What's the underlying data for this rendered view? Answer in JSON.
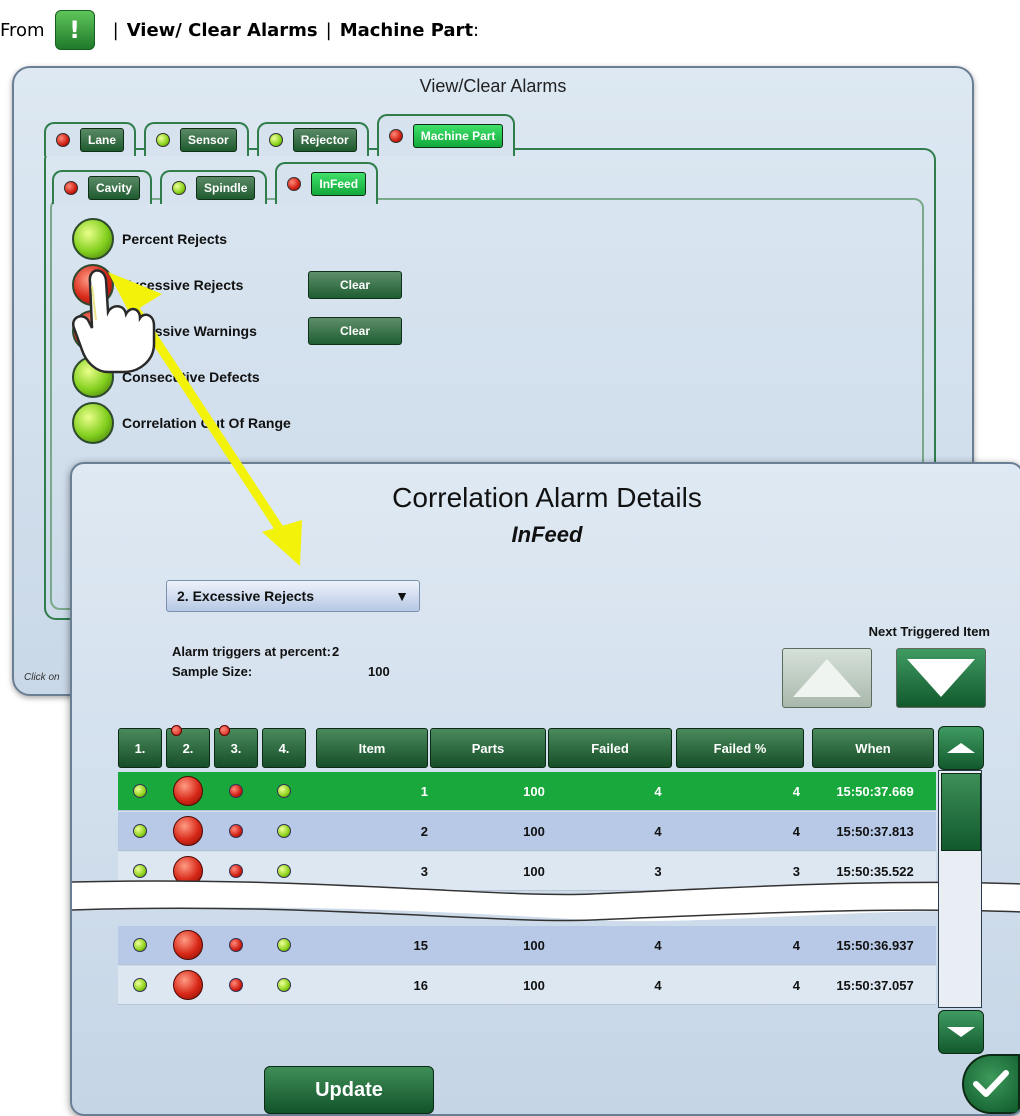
{
  "doc": {
    "prefix": "From",
    "icon_glyph": "!",
    "sep1": "|",
    "item1": "View/ Clear Alarms",
    "sep2": "|",
    "item2": "Machine Part",
    "suffix": ":"
  },
  "back_window": {
    "title": "View/Clear Alarms",
    "tabs": [
      {
        "label": "Lane",
        "led": "red"
      },
      {
        "label": "Sensor",
        "led": "green"
      },
      {
        "label": "Rejector",
        "led": "green"
      },
      {
        "label": "Machine Part",
        "led": "red",
        "active": true
      }
    ],
    "subtabs": [
      {
        "label": "Cavity",
        "led": "red"
      },
      {
        "label": "Spindle",
        "led": "green"
      },
      {
        "label": "InFeed",
        "led": "red",
        "active": true
      }
    ],
    "alarms": [
      {
        "label": "Percent Rejects",
        "led": "green"
      },
      {
        "label": "Excessive Rejects",
        "led": "red",
        "clear": "Clear"
      },
      {
        "label": "Excessive Warnings",
        "led": "red",
        "clear": "Clear"
      },
      {
        "label": "Consecutive Defects",
        "led": "green"
      },
      {
        "label": "Correlation Out Of Range",
        "led": "green"
      }
    ],
    "hint": "Click on"
  },
  "front_window": {
    "title": "Correlation Alarm Details",
    "subtitle": "InFeed",
    "dropdown_value": "2. Excessive Rejects",
    "dropdown_arrow": "▼",
    "next_triggered_label": "Next Triggered Item",
    "alarm_triggers_label": "Alarm triggers at percent:",
    "alarm_triggers_value": "2",
    "sample_size_label": "Sample Size:",
    "sample_size_value": "100",
    "columns": [
      "1.",
      "2.",
      "3.",
      "4.",
      "Item",
      "Parts",
      "Failed",
      "Failed %",
      "When"
    ],
    "rows": [
      {
        "item": "1",
        "parts": "100",
        "failed": "4",
        "failed_pct": "4",
        "when": "15:50:37.669"
      },
      {
        "item": "2",
        "parts": "100",
        "failed": "4",
        "failed_pct": "4",
        "when": "15:50:37.813"
      },
      {
        "item": "3",
        "parts": "100",
        "failed": "3",
        "failed_pct": "3",
        "when": "15:50:35.522"
      },
      {
        "item": "15",
        "parts": "100",
        "failed": "4",
        "failed_pct": "4",
        "when": "15:50:36.937"
      },
      {
        "item": "16",
        "parts": "100",
        "failed": "4",
        "failed_pct": "4",
        "when": "15:50:37.057"
      }
    ],
    "update_label": "Update"
  },
  "colors": {
    "accent_green": "#19a83c",
    "button_green": "#1e5a2e",
    "alarm_red": "#d01f12",
    "arrow_yellow": "#f2f20a"
  }
}
